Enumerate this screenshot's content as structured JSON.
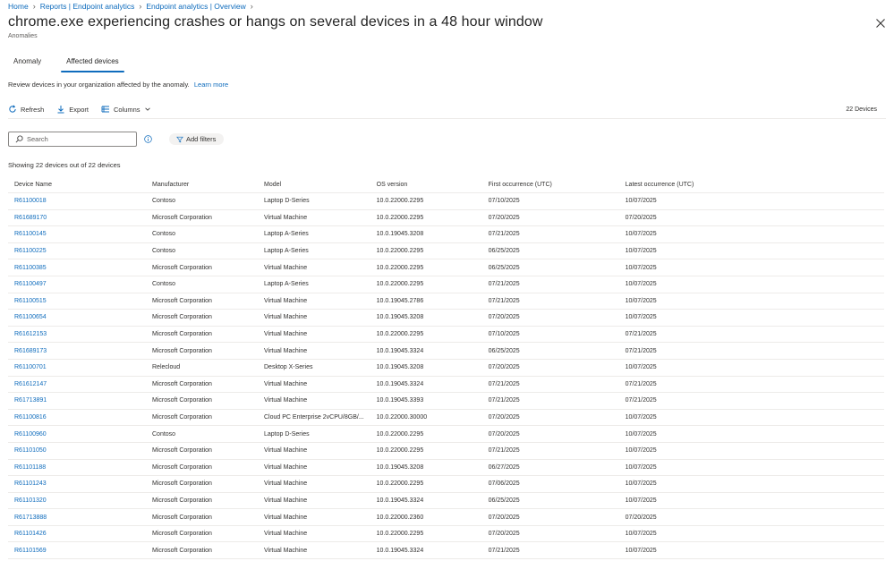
{
  "breadcrumb": {
    "items": [
      "Home",
      "Reports | Endpoint analytics",
      "Endpoint analytics | Overview"
    ]
  },
  "header": {
    "title": "chrome.exe experiencing crashes or hangs on several devices in a 48 hour window",
    "more": "···",
    "subtitle": "Anomalies"
  },
  "tabs": [
    {
      "label": "Anomaly"
    },
    {
      "label": "Affected devices",
      "active": true
    }
  ],
  "description": {
    "text": "Review devices in your organization affected by the anomaly.",
    "link": "Learn more"
  },
  "toolbar": {
    "refresh": "Refresh",
    "export": "Export",
    "columns": "Columns",
    "device_count": "22 Devices"
  },
  "search": {
    "placeholder": "Search"
  },
  "filters": {
    "add_label": "Add filters"
  },
  "summary": "Showing 22 devices out of 22 devices",
  "table": {
    "headers": [
      "Device Name",
      "Manufacturer",
      "Model",
      "OS version",
      "First occurrence (UTC)",
      "Latest occurrence (UTC)"
    ],
    "rows": [
      [
        "R61100018",
        "Contoso",
        "Laptop D-Series",
        "10.0.22000.2295",
        "07/10/2025",
        "10/07/2025"
      ],
      [
        "R61689170",
        "Microsoft Corporation",
        "Virtual Machine",
        "10.0.22000.2295",
        "07/20/2025",
        "07/20/2025"
      ],
      [
        "R61100145",
        "Contoso",
        "Laptop A-Series",
        "10.0.19045.3208",
        "07/21/2025",
        "10/07/2025"
      ],
      [
        "R61100225",
        "Contoso",
        "Laptop A-Series",
        "10.0.22000.2295",
        "06/25/2025",
        "10/07/2025"
      ],
      [
        "R61100385",
        "Microsoft Corporation",
        "Virtual Machine",
        "10.0.22000.2295",
        "06/25/2025",
        "10/07/2025"
      ],
      [
        "R61100497",
        "Contoso",
        "Laptop A-Series",
        "10.0.22000.2295",
        "07/21/2025",
        "10/07/2025"
      ],
      [
        "R61100515",
        "Microsoft Corporation",
        "Virtual Machine",
        "10.0.19045.2786",
        "07/21/2025",
        "10/07/2025"
      ],
      [
        "R61100654",
        "Microsoft Corporation",
        "Virtual Machine",
        "10.0.19045.3208",
        "07/20/2025",
        "10/07/2025"
      ],
      [
        "R61612153",
        "Microsoft Corporation",
        "Virtual Machine",
        "10.0.22000.2295",
        "07/10/2025",
        "07/21/2025"
      ],
      [
        "R61689173",
        "Microsoft Corporation",
        "Virtual Machine",
        "10.0.19045.3324",
        "06/25/2025",
        "07/21/2025"
      ],
      [
        "R61100701",
        "Relecloud",
        "Desktop X-Series",
        "10.0.19045.3208",
        "07/20/2025",
        "10/07/2025"
      ],
      [
        "R61612147",
        "Microsoft Corporation",
        "Virtual Machine",
        "10.0.19045.3324",
        "07/21/2025",
        "07/21/2025"
      ],
      [
        "R61713891",
        "Microsoft Corporation",
        "Virtual Machine",
        "10.0.19045.3393",
        "07/21/2025",
        "07/21/2025"
      ],
      [
        "R61100816",
        "Microsoft Corporation",
        "Cloud PC Enterprise 2vCPU/8GB/...",
        "10.0.22000.30000",
        "07/20/2025",
        "10/07/2025"
      ],
      [
        "R61100960",
        "Contoso",
        "Laptop D-Series",
        "10.0.22000.2295",
        "07/20/2025",
        "10/07/2025"
      ],
      [
        "R61101050",
        "Microsoft Corporation",
        "Virtual Machine",
        "10.0.22000.2295",
        "07/21/2025",
        "10/07/2025"
      ],
      [
        "R61101188",
        "Microsoft Corporation",
        "Virtual Machine",
        "10.0.19045.3208",
        "06/27/2025",
        "10/07/2025"
      ],
      [
        "R61101243",
        "Microsoft Corporation",
        "Virtual Machine",
        "10.0.22000.2295",
        "07/06/2025",
        "10/07/2025"
      ],
      [
        "R61101320",
        "Microsoft Corporation",
        "Virtual Machine",
        "10.0.19045.3324",
        "06/25/2025",
        "10/07/2025"
      ],
      [
        "R61713888",
        "Microsoft Corporation",
        "Virtual Machine",
        "10.0.22000.2360",
        "07/20/2025",
        "07/20/2025"
      ],
      [
        "R61101426",
        "Microsoft Corporation",
        "Virtual Machine",
        "10.0.22000.2295",
        "07/20/2025",
        "10/07/2025"
      ],
      [
        "R61101569",
        "Microsoft Corporation",
        "Virtual Machine",
        "10.0.19045.3324",
        "07/21/2025",
        "10/07/2025"
      ]
    ]
  },
  "colors": {
    "link": "#0f6cbd",
    "text": "#323130",
    "divider": "#edebe9"
  }
}
